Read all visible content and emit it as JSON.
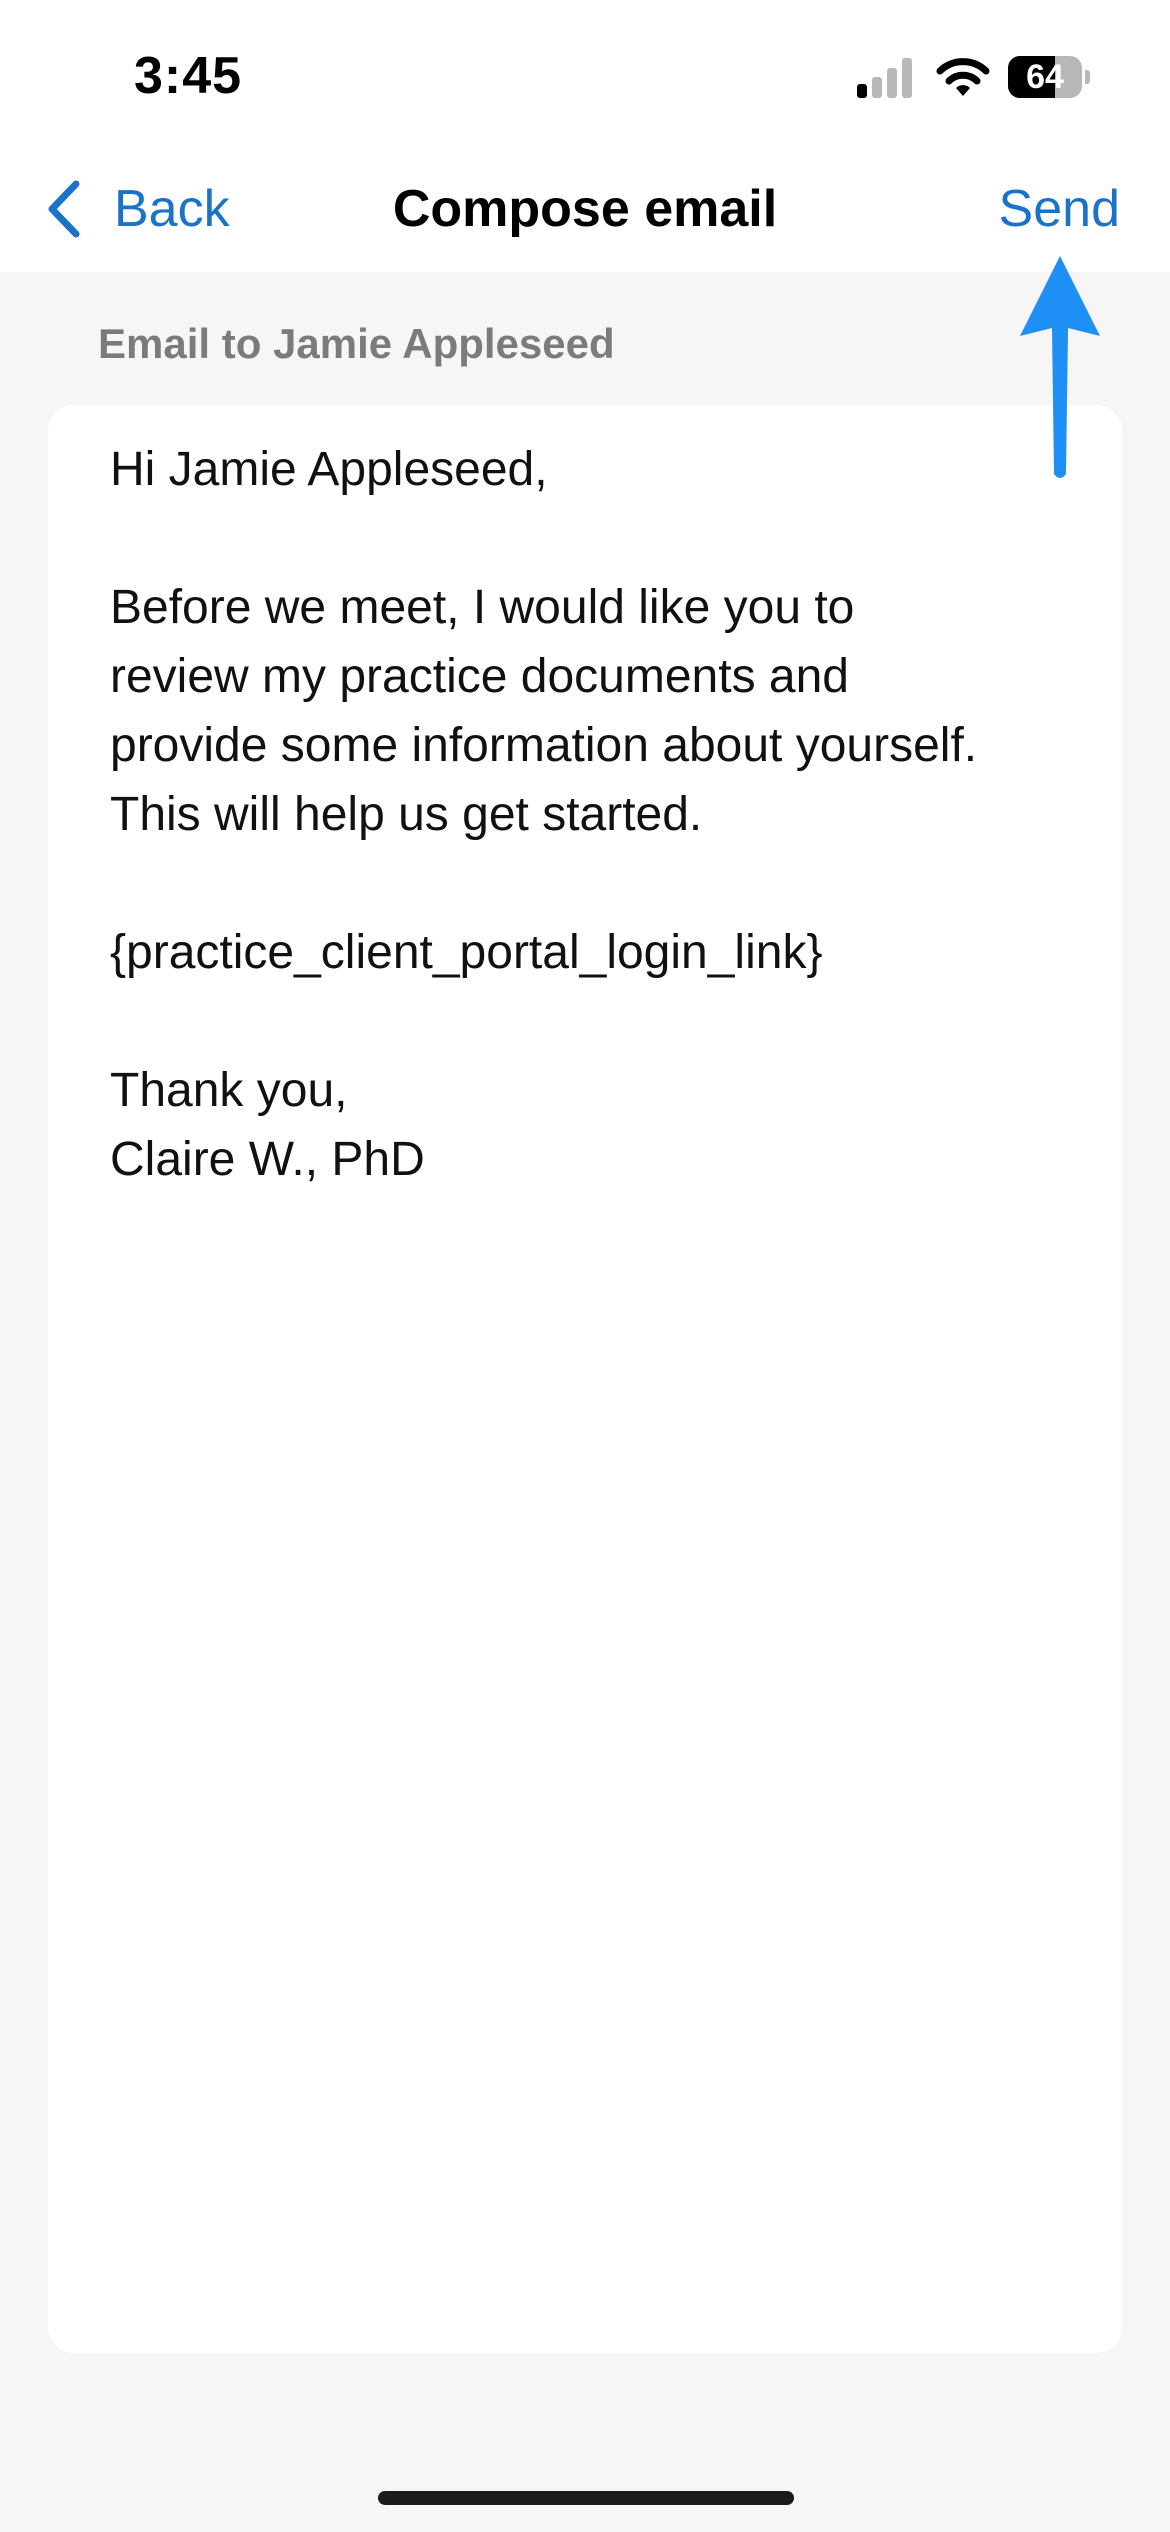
{
  "status_bar": {
    "time": "3:45",
    "battery_level": "64",
    "battery_fraction": 0.64,
    "signal_bars_active": 1,
    "signal_bars_total": 4,
    "icons": [
      "cellular-signal-icon",
      "wifi-icon",
      "battery-icon"
    ]
  },
  "nav": {
    "back_label": "Back",
    "back_icon": "chevron-left-icon",
    "title": "Compose email",
    "send_label": "Send"
  },
  "annotation": {
    "icon": "arrow-up-icon",
    "color": "#1e8ff5"
  },
  "compose": {
    "recipient_label": "Email to Jamie Appleseed",
    "body": "Hi Jamie Appleseed,\n\nBefore we meet, I would like you to\nreview my practice documents and\nprovide some information about yourself.\nThis will help us get started.\n\n{practice_client_portal_login_link}\n\nThank you,\nClaire W., PhD"
  },
  "colors": {
    "accent": "#1a73c8",
    "background": "#f6f6f6",
    "card": "#ffffff",
    "secondary_text": "#7b7b7b"
  }
}
